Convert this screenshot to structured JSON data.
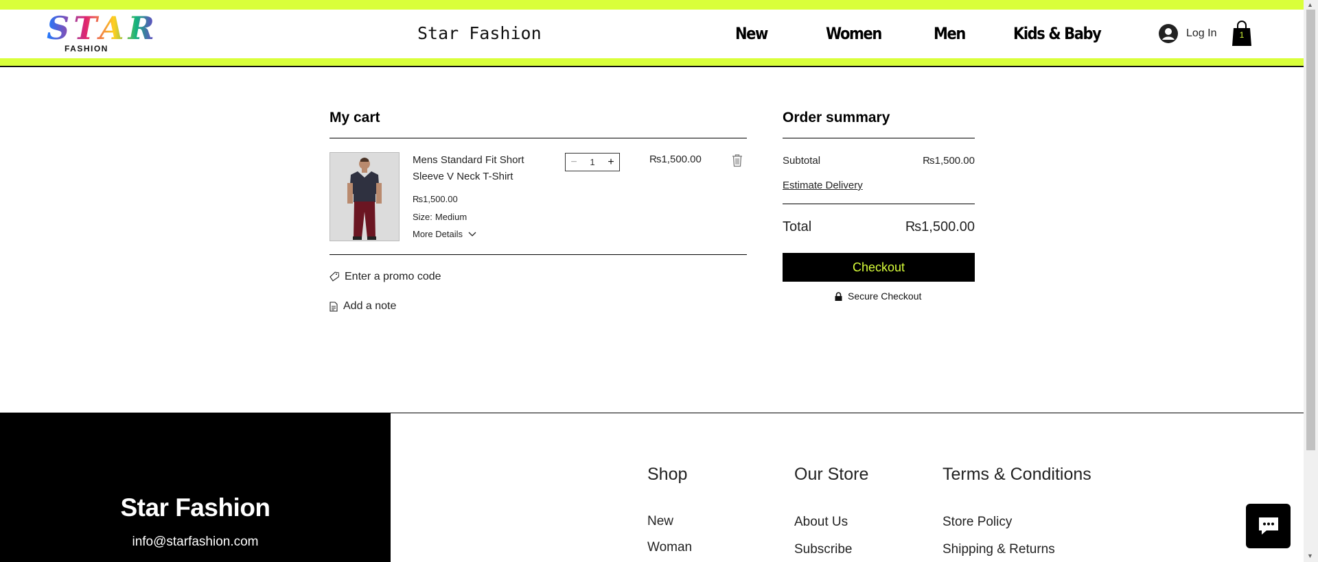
{
  "header": {
    "logo_text": "STAR",
    "logo_sub": "FASHION",
    "site_title": "Star Fashion",
    "nav": [
      {
        "label": "New"
      },
      {
        "label": "Women"
      },
      {
        "label": "Men"
      },
      {
        "label": "Kids & Baby"
      }
    ],
    "login_label": "Log In",
    "cart_count": "1",
    "accent_color": "#d9ff3a"
  },
  "cart": {
    "title": "My cart",
    "item": {
      "name": "Mens Standard Fit Short Sleeve V Neck T-Shirt",
      "price": "₨1,500.00",
      "size_label": "Size:",
      "size_value": "Medium",
      "more_details": "More Details",
      "quantity": "1",
      "line_total": "₨1,500.00"
    },
    "promo_label": "Enter a promo code",
    "note_label": "Add a note"
  },
  "summary": {
    "title": "Order summary",
    "subtotal_label": "Subtotal",
    "subtotal_value": "₨1,500.00",
    "estimate_delivery": "Estimate Delivery",
    "total_label": "Total",
    "total_value": "₨1,500.00",
    "checkout_label": "Checkout",
    "secure_label": "Secure Checkout"
  },
  "footer": {
    "brand": "Star Fashion",
    "email": "info@starfashion.com",
    "shop": {
      "title": "Shop",
      "links": [
        "New",
        "Woman"
      ]
    },
    "store": {
      "title": "Our Store",
      "links": [
        "About Us",
        "Subscribe"
      ]
    },
    "terms": {
      "title": "Terms & Conditions",
      "links": [
        "Store Policy",
        "Shipping & Returns"
      ]
    }
  },
  "icons": {
    "user": "user-avatar-icon",
    "cart": "shopping-bag-icon",
    "trash": "trash-icon",
    "tag": "tag-icon",
    "note": "note-icon",
    "lock": "lock-icon",
    "chat": "chat-icon",
    "chevron": "chevron-down-icon"
  }
}
